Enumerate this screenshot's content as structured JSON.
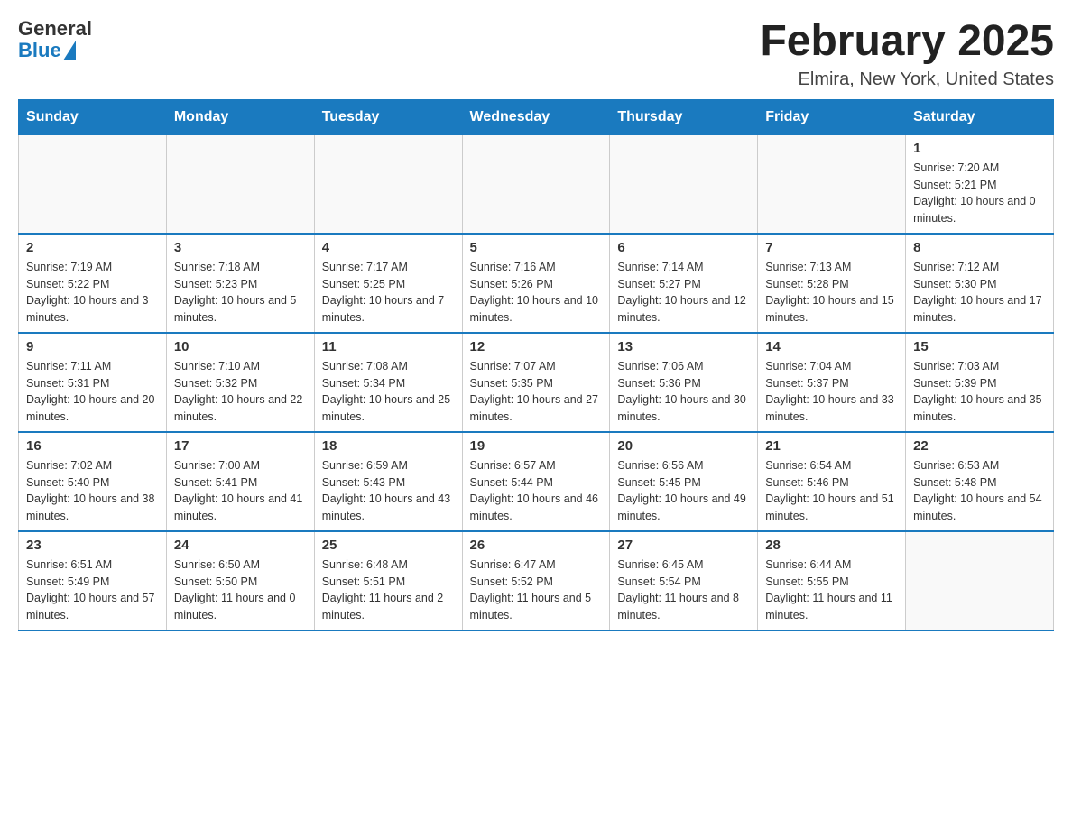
{
  "header": {
    "logo_general": "General",
    "logo_blue": "Blue",
    "month_title": "February 2025",
    "location": "Elmira, New York, United States"
  },
  "days_of_week": [
    "Sunday",
    "Monday",
    "Tuesday",
    "Wednesday",
    "Thursday",
    "Friday",
    "Saturday"
  ],
  "weeks": [
    [
      {
        "day": "",
        "info": ""
      },
      {
        "day": "",
        "info": ""
      },
      {
        "day": "",
        "info": ""
      },
      {
        "day": "",
        "info": ""
      },
      {
        "day": "",
        "info": ""
      },
      {
        "day": "",
        "info": ""
      },
      {
        "day": "1",
        "info": "Sunrise: 7:20 AM\nSunset: 5:21 PM\nDaylight: 10 hours and 0 minutes."
      }
    ],
    [
      {
        "day": "2",
        "info": "Sunrise: 7:19 AM\nSunset: 5:22 PM\nDaylight: 10 hours and 3 minutes."
      },
      {
        "day": "3",
        "info": "Sunrise: 7:18 AM\nSunset: 5:23 PM\nDaylight: 10 hours and 5 minutes."
      },
      {
        "day": "4",
        "info": "Sunrise: 7:17 AM\nSunset: 5:25 PM\nDaylight: 10 hours and 7 minutes."
      },
      {
        "day": "5",
        "info": "Sunrise: 7:16 AM\nSunset: 5:26 PM\nDaylight: 10 hours and 10 minutes."
      },
      {
        "day": "6",
        "info": "Sunrise: 7:14 AM\nSunset: 5:27 PM\nDaylight: 10 hours and 12 minutes."
      },
      {
        "day": "7",
        "info": "Sunrise: 7:13 AM\nSunset: 5:28 PM\nDaylight: 10 hours and 15 minutes."
      },
      {
        "day": "8",
        "info": "Sunrise: 7:12 AM\nSunset: 5:30 PM\nDaylight: 10 hours and 17 minutes."
      }
    ],
    [
      {
        "day": "9",
        "info": "Sunrise: 7:11 AM\nSunset: 5:31 PM\nDaylight: 10 hours and 20 minutes."
      },
      {
        "day": "10",
        "info": "Sunrise: 7:10 AM\nSunset: 5:32 PM\nDaylight: 10 hours and 22 minutes."
      },
      {
        "day": "11",
        "info": "Sunrise: 7:08 AM\nSunset: 5:34 PM\nDaylight: 10 hours and 25 minutes."
      },
      {
        "day": "12",
        "info": "Sunrise: 7:07 AM\nSunset: 5:35 PM\nDaylight: 10 hours and 27 minutes."
      },
      {
        "day": "13",
        "info": "Sunrise: 7:06 AM\nSunset: 5:36 PM\nDaylight: 10 hours and 30 minutes."
      },
      {
        "day": "14",
        "info": "Sunrise: 7:04 AM\nSunset: 5:37 PM\nDaylight: 10 hours and 33 minutes."
      },
      {
        "day": "15",
        "info": "Sunrise: 7:03 AM\nSunset: 5:39 PM\nDaylight: 10 hours and 35 minutes."
      }
    ],
    [
      {
        "day": "16",
        "info": "Sunrise: 7:02 AM\nSunset: 5:40 PM\nDaylight: 10 hours and 38 minutes."
      },
      {
        "day": "17",
        "info": "Sunrise: 7:00 AM\nSunset: 5:41 PM\nDaylight: 10 hours and 41 minutes."
      },
      {
        "day": "18",
        "info": "Sunrise: 6:59 AM\nSunset: 5:43 PM\nDaylight: 10 hours and 43 minutes."
      },
      {
        "day": "19",
        "info": "Sunrise: 6:57 AM\nSunset: 5:44 PM\nDaylight: 10 hours and 46 minutes."
      },
      {
        "day": "20",
        "info": "Sunrise: 6:56 AM\nSunset: 5:45 PM\nDaylight: 10 hours and 49 minutes."
      },
      {
        "day": "21",
        "info": "Sunrise: 6:54 AM\nSunset: 5:46 PM\nDaylight: 10 hours and 51 minutes."
      },
      {
        "day": "22",
        "info": "Sunrise: 6:53 AM\nSunset: 5:48 PM\nDaylight: 10 hours and 54 minutes."
      }
    ],
    [
      {
        "day": "23",
        "info": "Sunrise: 6:51 AM\nSunset: 5:49 PM\nDaylight: 10 hours and 57 minutes."
      },
      {
        "day": "24",
        "info": "Sunrise: 6:50 AM\nSunset: 5:50 PM\nDaylight: 11 hours and 0 minutes."
      },
      {
        "day": "25",
        "info": "Sunrise: 6:48 AM\nSunset: 5:51 PM\nDaylight: 11 hours and 2 minutes."
      },
      {
        "day": "26",
        "info": "Sunrise: 6:47 AM\nSunset: 5:52 PM\nDaylight: 11 hours and 5 minutes."
      },
      {
        "day": "27",
        "info": "Sunrise: 6:45 AM\nSunset: 5:54 PM\nDaylight: 11 hours and 8 minutes."
      },
      {
        "day": "28",
        "info": "Sunrise: 6:44 AM\nSunset: 5:55 PM\nDaylight: 11 hours and 11 minutes."
      },
      {
        "day": "",
        "info": ""
      }
    ]
  ]
}
